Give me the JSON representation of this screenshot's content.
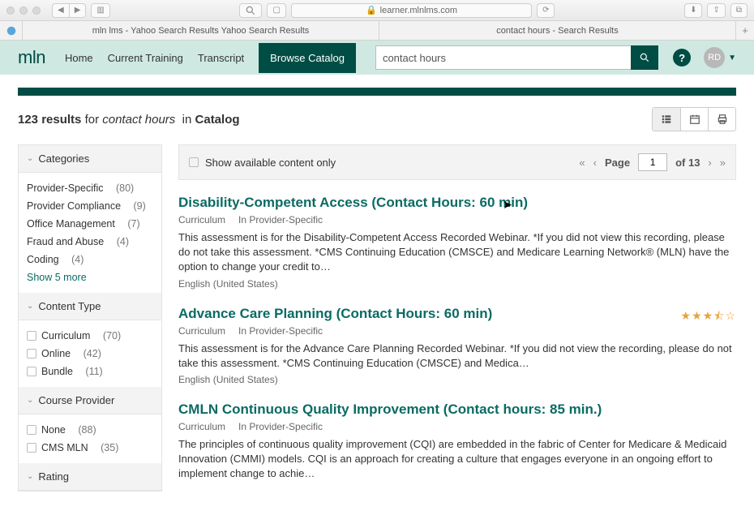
{
  "browser": {
    "url": "learner.mlnlms.com",
    "tabs": [
      "mln lms - Yahoo Search Results Yahoo Search Results",
      "contact hours - Search Results"
    ]
  },
  "header": {
    "logo": "mln",
    "nav": {
      "home": "Home",
      "current": "Current Training",
      "transcript": "Transcript",
      "browse": "Browse Catalog"
    },
    "search_value": "contact hours",
    "avatar_initials": "RD"
  },
  "results_summary": {
    "count": "123 results",
    "for_label": "for",
    "query": "contact hours",
    "in_label": "in",
    "scope": "Catalog"
  },
  "filters": {
    "categories": {
      "title": "Categories",
      "items": [
        {
          "label": "Provider-Specific",
          "count": "(80)"
        },
        {
          "label": "Provider Compliance",
          "count": "(9)"
        },
        {
          "label": "Office Management",
          "count": "(7)"
        },
        {
          "label": "Fraud and Abuse",
          "count": "(4)"
        },
        {
          "label": "Coding",
          "count": "(4)"
        }
      ],
      "show_more": "Show 5 more"
    },
    "content_type": {
      "title": "Content Type",
      "items": [
        {
          "label": "Curriculum",
          "count": "(70)"
        },
        {
          "label": "Online",
          "count": "(42)"
        },
        {
          "label": "Bundle",
          "count": "(11)"
        }
      ]
    },
    "course_provider": {
      "title": "Course Provider",
      "items": [
        {
          "label": "None",
          "count": "(88)"
        },
        {
          "label": "CMS MLN",
          "count": "(35)"
        }
      ]
    },
    "rating": {
      "title": "Rating"
    }
  },
  "toolbar": {
    "available_only": "Show available content only",
    "page_label": "Page",
    "page_current": "1",
    "page_total": "of 13"
  },
  "results": [
    {
      "title": "Disability-Competent Access (Contact Hours: 60 min)",
      "type": "Curriculum",
      "category": "In Provider-Specific",
      "desc": "This assessment is for the Disability-Competent Access Recorded Webinar. *If you did not view this recording, please do not take this assessment. *CMS Continuing Education (CMSCE) and Medicare Learning Network® (MLN) have the option to change your credit to…",
      "lang": "English (United States)"
    },
    {
      "title": "Advance Care Planning (Contact Hours: 60 min)",
      "type": "Curriculum",
      "category": "In Provider-Specific",
      "desc": "This assessment is for the Advance Care Planning Recorded Webinar. *If you did not view the recording, please do not take this assessment. *CMS Continuing Education (CMSCE) and Medica…",
      "lang": "English (United States)",
      "stars": "★★★⯪☆"
    },
    {
      "title": "CMLN Continuous Quality Improvement (Contact hours: 85 min.)",
      "type": "Curriculum",
      "category": "In Provider-Specific",
      "desc": "The principles of continuous quality improvement (CQI) are embedded in the fabric of Center for Medicare & Medicaid Innovation (CMMI) models. CQI is an approach for creating a culture that engages everyone in an ongoing effort to implement change to achie…",
      "lang": ""
    }
  ]
}
